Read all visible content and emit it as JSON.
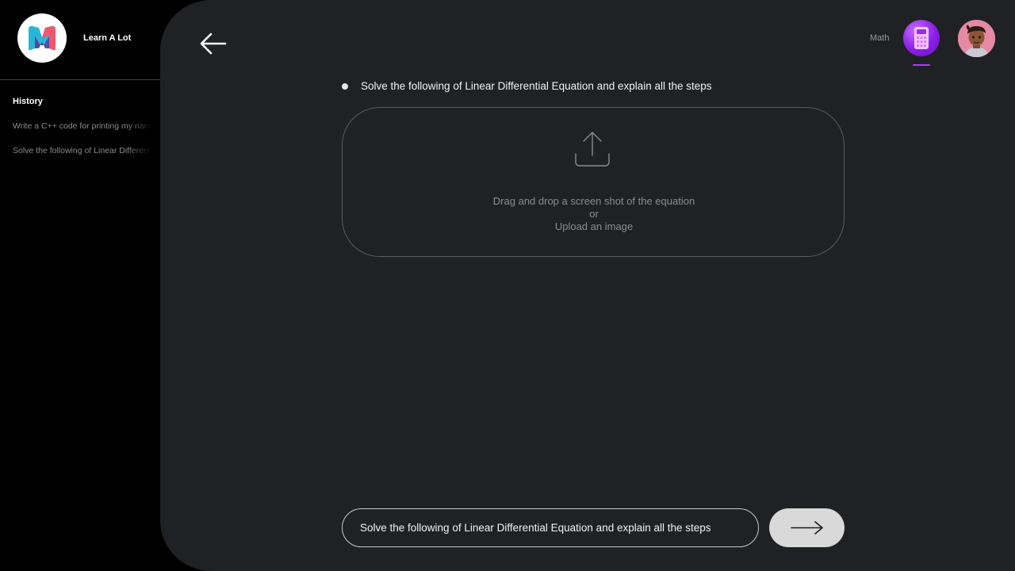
{
  "app": {
    "name": "Learn A Lot"
  },
  "sidebar": {
    "history_title": "History",
    "items": [
      {
        "label": "Write a C++ code for printing my name"
      },
      {
        "label": "Solve the following of Linear Differential Equation"
      }
    ]
  },
  "header": {
    "subject_label": "Math",
    "subject_icon": "calculator-icon",
    "accent": "#a93dff"
  },
  "question": {
    "text": "Solve the following of Linear Differential Equation and explain all the steps"
  },
  "dropzone": {
    "line1": "Drag and drop a screen shot of the equation",
    "line2": "or",
    "line3": "Upload an image"
  },
  "composer": {
    "value": "Solve the following of Linear Differential Equation and explain all the steps"
  }
}
